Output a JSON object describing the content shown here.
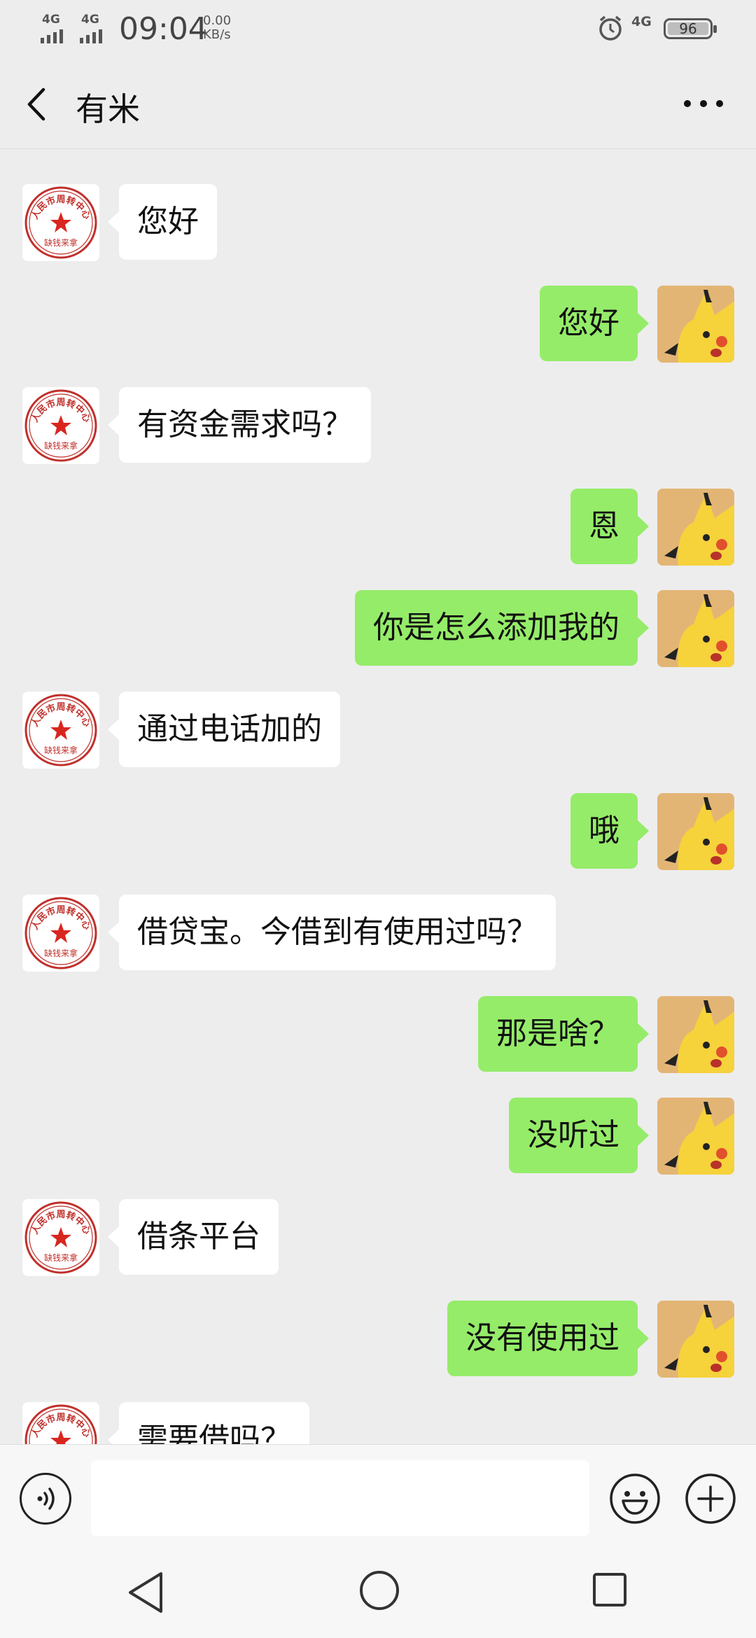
{
  "status_bar": {
    "network_1": "4G",
    "network_2": "4G",
    "time": "09:04",
    "speed_value": "0.00",
    "speed_unit": "KB/s",
    "network_right": "4G",
    "battery": "96"
  },
  "header": {
    "title": "有米",
    "back_icon": "chevron-left-icon",
    "more_icon": "more-dots-icon"
  },
  "contact_avatar": {
    "stamp_top_text": "人民市周转中心",
    "stamp_bottom_text": "缺钱来拿",
    "stamp_color": "#c0302b"
  },
  "my_avatar": {
    "icon": "pikachu-avatar-icon",
    "bg_color": "#e3b575"
  },
  "messages": [
    {
      "side": "left",
      "text": "您好"
    },
    {
      "side": "right",
      "text": "您好"
    },
    {
      "side": "left",
      "text": "有资金需求吗？"
    },
    {
      "side": "right",
      "text": "恩"
    },
    {
      "side": "right",
      "text": "你是怎么添加我的"
    },
    {
      "side": "left",
      "text": "通过电话加的"
    },
    {
      "side": "right",
      "text": "哦"
    },
    {
      "side": "left",
      "text": "借贷宝。今借到有使用过吗？"
    },
    {
      "side": "right",
      "text": "那是啥？"
    },
    {
      "side": "right",
      "text": "没听过"
    },
    {
      "side": "left",
      "text": "借条平台"
    },
    {
      "side": "right",
      "text": "没有使用过"
    },
    {
      "side": "left",
      "text": "需要借吗？"
    }
  ],
  "input_bar": {
    "value": "",
    "placeholder": "",
    "voice_icon": "voice-icon",
    "emoji_icon": "emoji-icon",
    "plus_icon": "plus-icon"
  },
  "nav_bar": {
    "back_icon": "nav-back-icon",
    "home_icon": "nav-home-icon",
    "recent_icon": "nav-recent-icon"
  },
  "colors": {
    "background": "#ededed",
    "sent_bubble": "#95ec69",
    "received_bubble": "#ffffff"
  }
}
